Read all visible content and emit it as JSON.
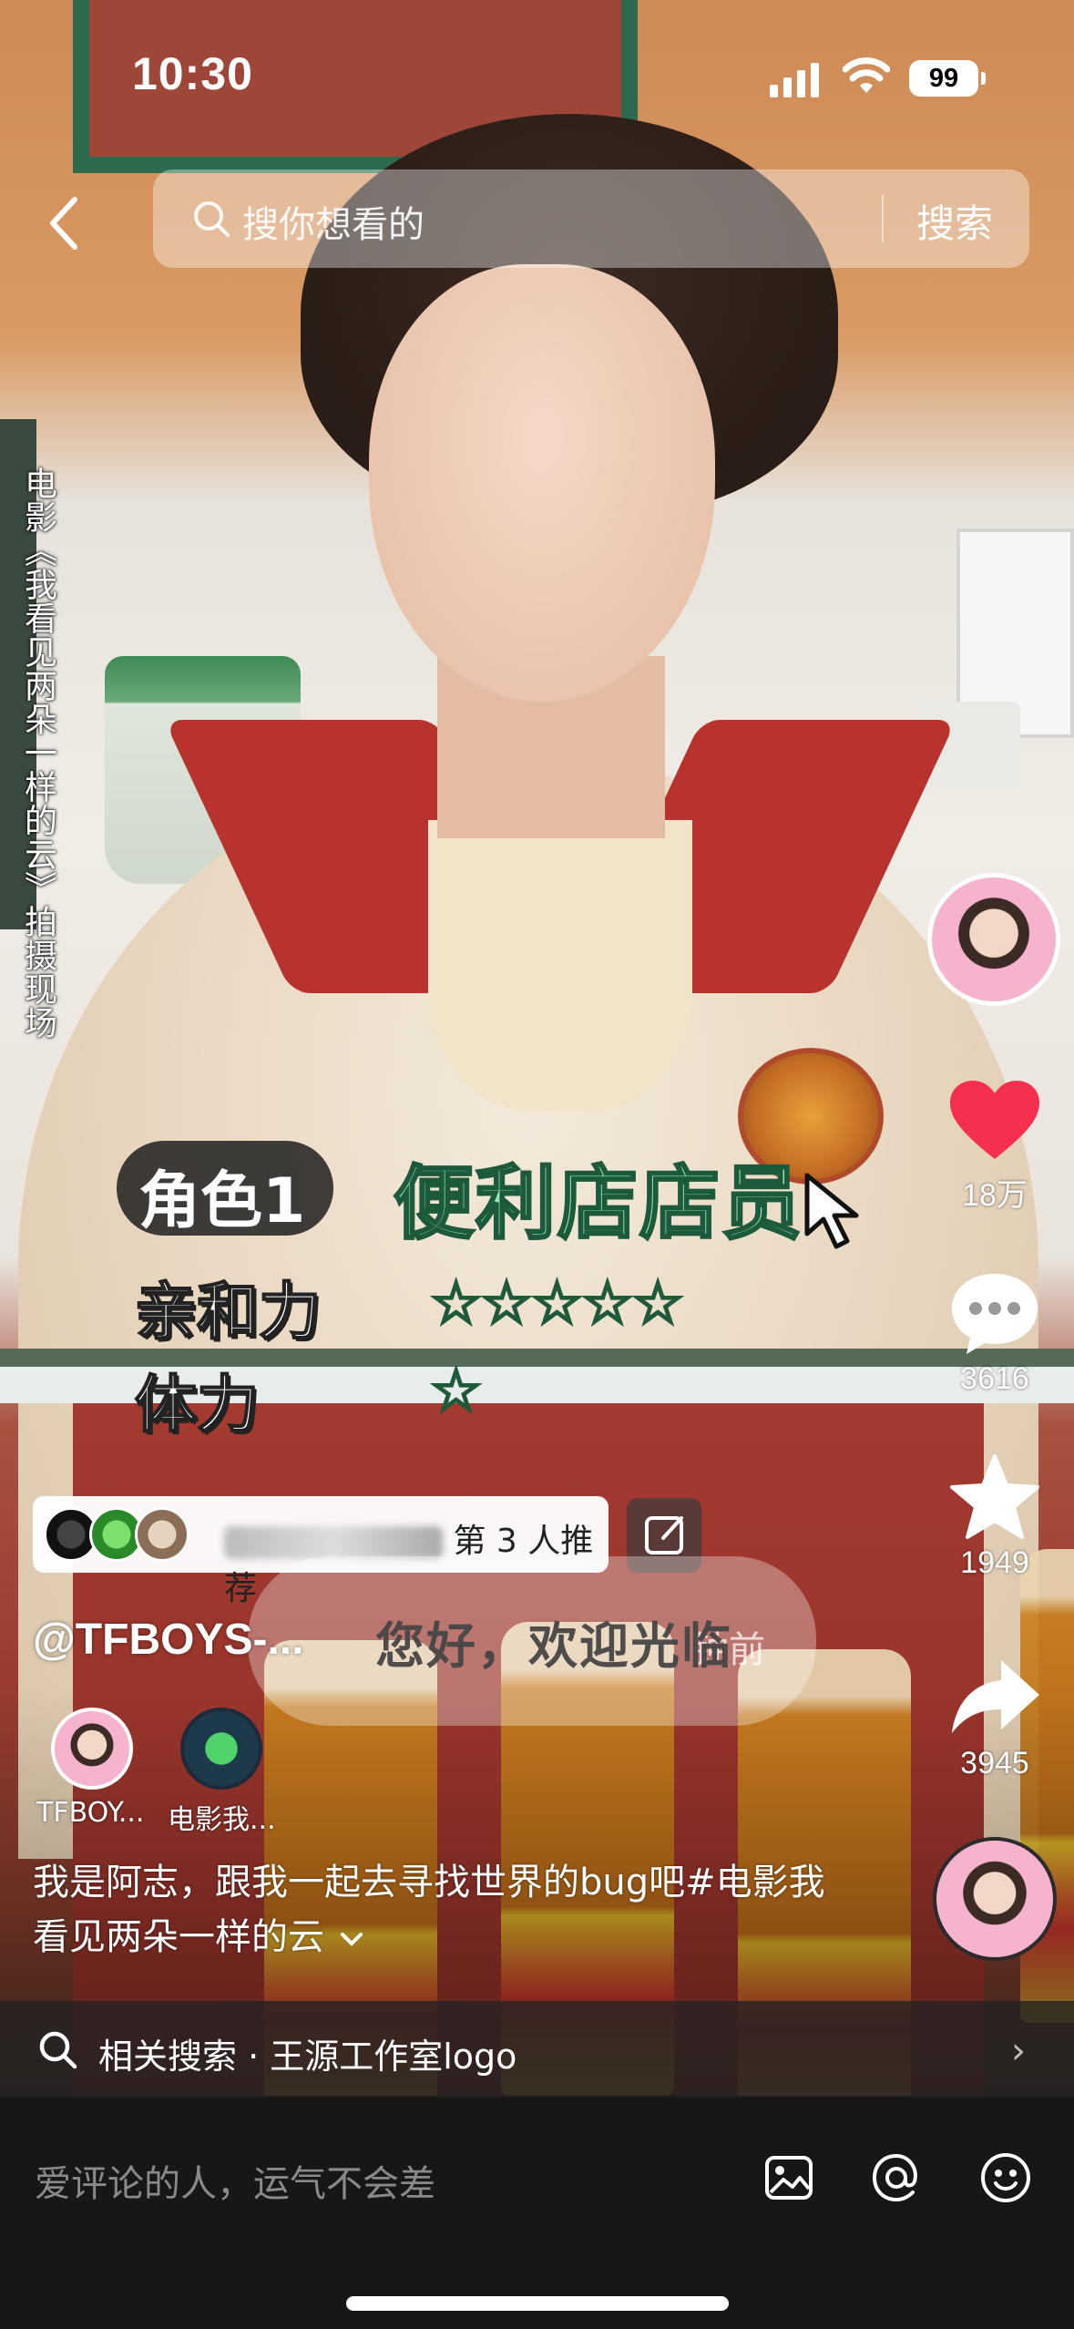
{
  "status_bar": {
    "time": "10:30",
    "battery": "99"
  },
  "search": {
    "placeholder": "搜你想看的",
    "button": "搜索"
  },
  "side_caption": "电影《我看见两朵一样的云》拍摄现场",
  "overlay": {
    "role_label": "角色1",
    "role_value": "便利店店员",
    "attributes": [
      {
        "label": "亲和力",
        "stars": "☆☆☆☆☆",
        "rating": 5
      },
      {
        "label": "体力",
        "stars": "☆",
        "rating": 1
      }
    ]
  },
  "actions": {
    "like_count": "18万",
    "comment_count": "3616",
    "favorite_count": "1949",
    "share_count": "3945"
  },
  "recommend": {
    "text_suffix": "第 3 人推荐"
  },
  "bubble_text": "您好，欢迎光临",
  "author": "@TFBOYS-...",
  "time_ago": "钟前",
  "mentions": [
    {
      "label": "TFBOY..."
    },
    {
      "label": "电影我..."
    }
  ],
  "description": "我是阿志，跟我一起去寻找世界的bug吧#电影我看见两朵一样的云",
  "related_search": {
    "label": "相关搜索 · 王源工作室logo"
  },
  "comment_bar": {
    "placeholder": "爱评论的人，运气不会差"
  },
  "colors": {
    "accent_green": "#8fe6b7",
    "like_red": "#f5304f",
    "bar_bg": "#171717"
  },
  "icons": [
    "back-icon",
    "search-icon",
    "cursor-icon",
    "heart-icon",
    "comment-icon",
    "star-icon",
    "share-icon",
    "edit-icon",
    "chevron-right-icon",
    "image-icon",
    "at-icon",
    "emoji-icon"
  ]
}
